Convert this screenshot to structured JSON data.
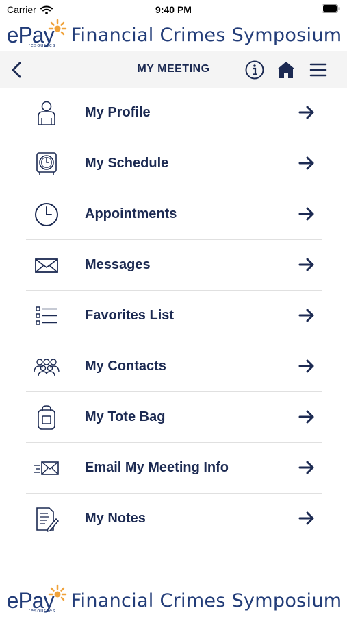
{
  "status_bar": {
    "carrier": "Carrier",
    "time": "9:40 PM"
  },
  "banner": {
    "logo_text": "ePay",
    "logo_subtext": "resources",
    "title": "Financial Crimes Symposium"
  },
  "nav": {
    "title": "MY MEETING",
    "back_icon": "chevron-left-icon",
    "info_icon": "info-icon",
    "home_icon": "home-icon",
    "menu_icon": "hamburger-icon"
  },
  "menu": {
    "items": [
      {
        "label": "My Profile",
        "icon": "person-icon"
      },
      {
        "label": "My Schedule",
        "icon": "clock-box-icon"
      },
      {
        "label": "Appointments",
        "icon": "clock-icon"
      },
      {
        "label": "Messages",
        "icon": "envelope-icon"
      },
      {
        "label": "Favorites List",
        "icon": "checklist-icon"
      },
      {
        "label": "My Contacts",
        "icon": "group-icon"
      },
      {
        "label": "My Tote Bag",
        "icon": "bag-icon"
      },
      {
        "label": "Email My Meeting Info",
        "icon": "send-mail-icon"
      },
      {
        "label": "My Notes",
        "icon": "notes-icon"
      }
    ]
  },
  "colors": {
    "navy": "#1c2a52",
    "brand_blue": "#223c78",
    "sun_orange": "#f0a23a",
    "nav_bg": "#f4f4f4",
    "divider": "#e0e0e0"
  }
}
